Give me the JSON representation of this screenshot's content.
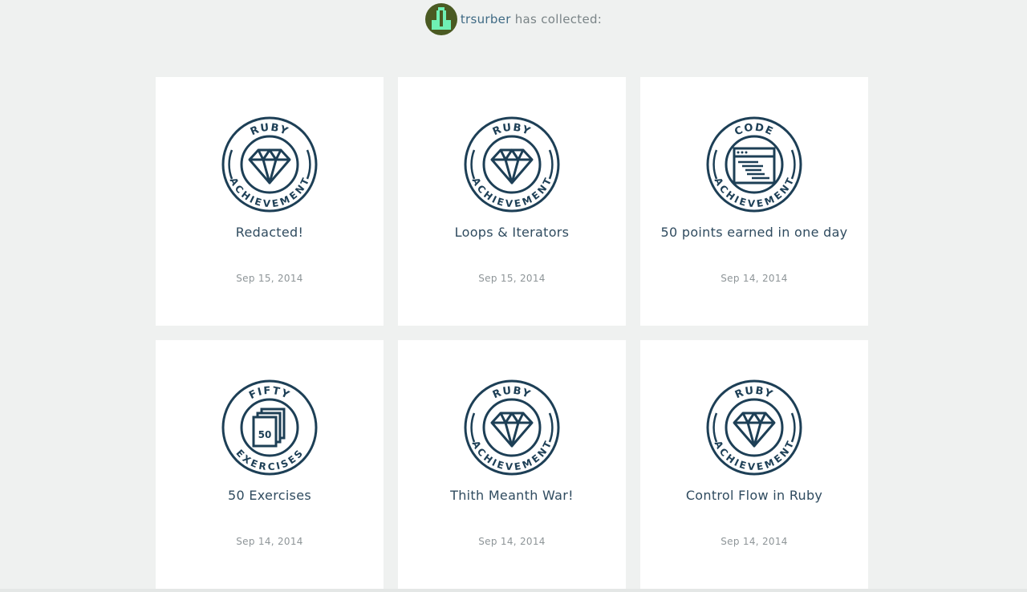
{
  "header": {
    "username": "trsurber",
    "suffix": " has collected:"
  },
  "colors": {
    "badge_ink": "#1d3f56",
    "title": "#2f4b5f",
    "date": "#8e9598",
    "avatar_bg": "#4a5a22",
    "avatar_fg": "#6ff0b4"
  },
  "achievements": [
    {
      "title": "Redacted!",
      "date": "Sep 15, 2014",
      "badge": {
        "type": "ruby",
        "top": "RUBY",
        "bottom": "ACHIEVEMENT",
        "icon": "gem-icon"
      }
    },
    {
      "title": "Loops & Iterators",
      "date": "Sep 15, 2014",
      "badge": {
        "type": "ruby",
        "top": "RUBY",
        "bottom": "ACHIEVEMENT",
        "icon": "gem-icon"
      }
    },
    {
      "title": "50 points earned in one day",
      "date": "Sep 14, 2014",
      "badge": {
        "type": "code",
        "top": "CODE",
        "bottom": "ACHIEVEMENT",
        "icon": "code-window-icon"
      }
    },
    {
      "title": "50 Exercises",
      "date": "Sep 14, 2014",
      "badge": {
        "type": "fifty",
        "top": "FIFTY",
        "bottom": "EXERCISES",
        "icon": "stacked-pages-icon",
        "icon_text": "50"
      }
    },
    {
      "title": "Thith Meanth War!",
      "date": "Sep 14, 2014",
      "badge": {
        "type": "ruby",
        "top": "RUBY",
        "bottom": "ACHIEVEMENT",
        "icon": "gem-icon"
      }
    },
    {
      "title": "Control Flow in Ruby",
      "date": "Sep 14, 2014",
      "badge": {
        "type": "ruby",
        "top": "RUBY",
        "bottom": "ACHIEVEMENT",
        "icon": "gem-icon"
      }
    }
  ]
}
